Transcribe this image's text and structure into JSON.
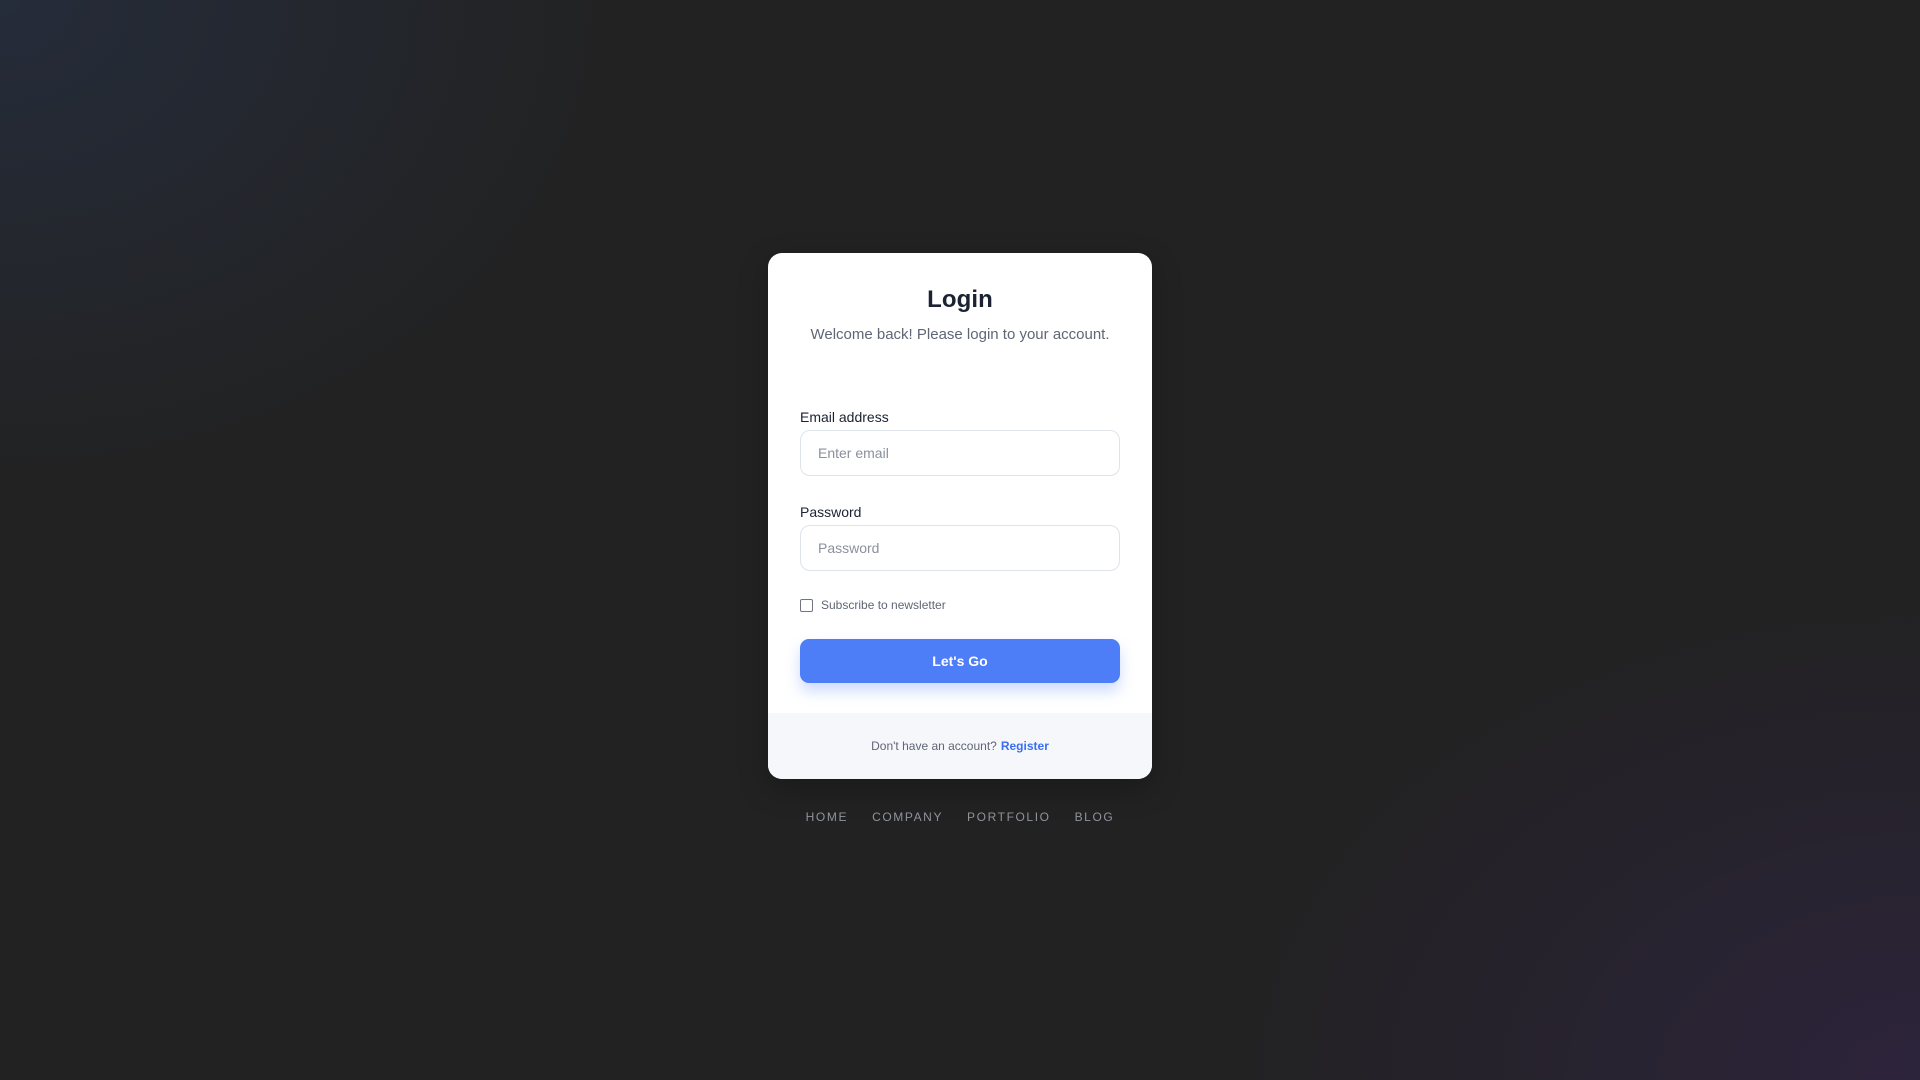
{
  "login": {
    "title": "Login",
    "subtitle": "Welcome back! Please login to your account.",
    "email": {
      "label": "Email address",
      "placeholder": "Enter email",
      "value": ""
    },
    "password": {
      "label": "Password",
      "placeholder": "Password",
      "value": ""
    },
    "newsletter": {
      "label": "Subscribe to newsletter",
      "checked": false
    },
    "submit_label": "Let's Go",
    "footer": {
      "prompt": "Don't have an account?",
      "register_label": "Register"
    }
  },
  "nav": {
    "items": [
      {
        "label": "HOME"
      },
      {
        "label": "COMPANY"
      },
      {
        "label": "PORTFOLIO"
      },
      {
        "label": "BLOG"
      }
    ]
  },
  "colors": {
    "background": "#222222",
    "card": "#ffffff",
    "accent": "#4d7ef7",
    "link": "#3a6ff0",
    "footer_bg": "#f5f7fb"
  }
}
